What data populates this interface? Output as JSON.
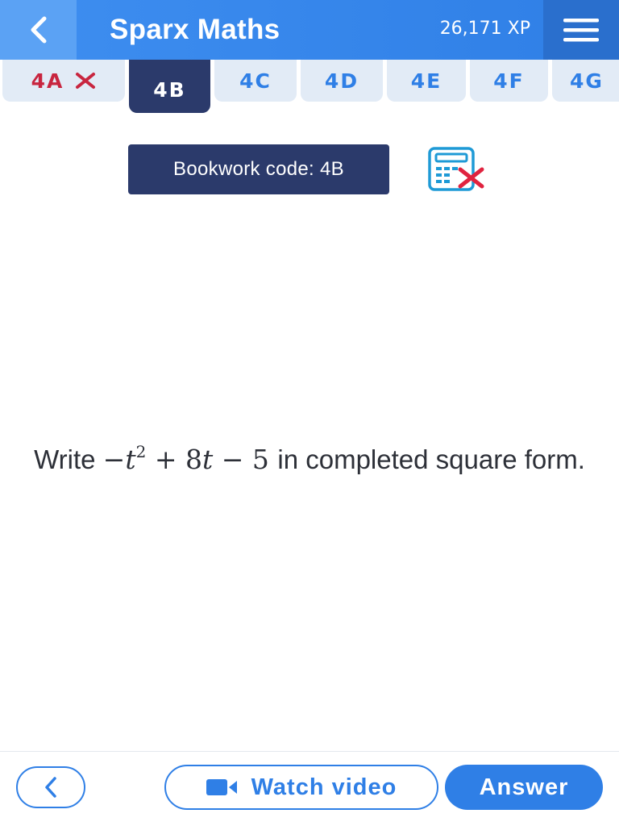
{
  "header": {
    "title": "Sparx Maths",
    "xp": "26,171 XP",
    "back_icon": "chevron-left-icon",
    "menu_icon": "hamburger-menu-icon"
  },
  "tabs": [
    {
      "label": "4A",
      "status": "wrong"
    },
    {
      "label": "4B",
      "status": "active"
    },
    {
      "label": "4C",
      "status": "normal"
    },
    {
      "label": "4D",
      "status": "normal"
    },
    {
      "label": "4E",
      "status": "normal"
    },
    {
      "label": "4F",
      "status": "normal"
    },
    {
      "label": "4G",
      "status": "normal"
    }
  ],
  "bookwork": {
    "label": "Bookwork code: 4B",
    "calculator_icon": "calculator-not-allowed-icon"
  },
  "question": {
    "prefix": "Write",
    "math_var": "t",
    "math_power": "2",
    "math_rest": "+ 8",
    "math_rest_var": "t",
    "math_tail": "− 5",
    "suffix": "in completed square form."
  },
  "footer": {
    "watch_label": "Watch video",
    "answer_label": "Answer"
  },
  "colors": {
    "header_blue": "#2f7fe6",
    "dark_navy": "#2b3a6b",
    "wrong_red": "#c8253f",
    "tab_bg": "#e2ebf6"
  }
}
